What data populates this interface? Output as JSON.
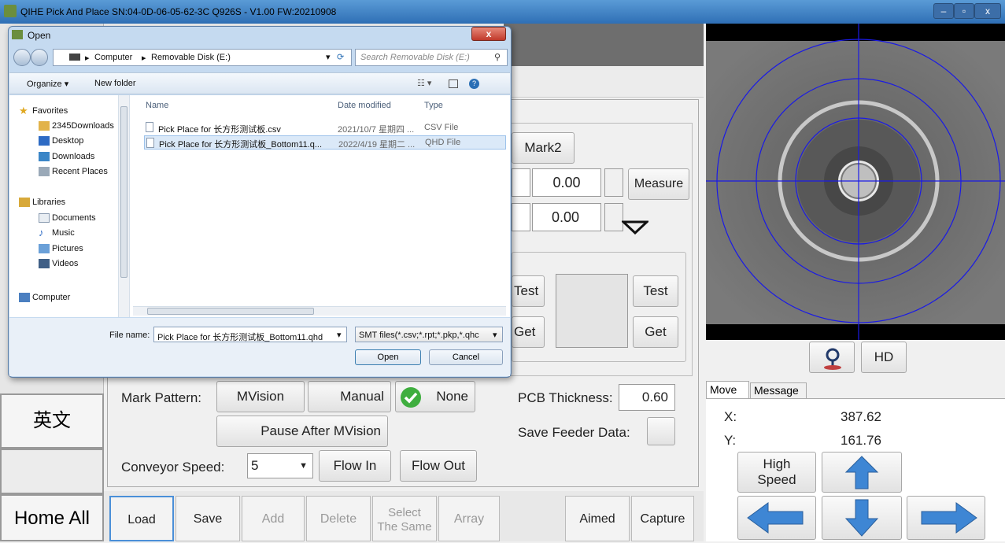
{
  "window": {
    "title": "QIHE Pick And Place   SN:04-0D-06-05-62-3C  Q926S - V1.00   FW:20210908"
  },
  "sidebar": {
    "english_btn": "英文",
    "home_btn": "Home All"
  },
  "panel": {
    "mark2": "Mark2",
    "field1": "0.00",
    "field2": "0.00",
    "measure": "Measure",
    "test_left": "Test",
    "get_left": "Get",
    "test_right": "Test",
    "get_right": "Get",
    "mark_pattern_label": "Mark Pattern:",
    "mvision": "MVision",
    "manual": "Manual",
    "none": "None",
    "pcb_thickness_label": "PCB Thickness:",
    "pcb_thickness_value": "0.60",
    "pause_after_mvision": "Pause After MVision",
    "save_feeder_label": "Save Feeder Data:",
    "conveyor_label": "Conveyor  Speed:",
    "speed_value": "5",
    "flow_in": "Flow In",
    "flow_out": "Flow Out"
  },
  "toolbar": {
    "load": "Load",
    "save": "Save",
    "add": "Add",
    "delete": "Delete",
    "select_same_1": "Select",
    "select_same_2": "The Same",
    "array": "Array",
    "aimed": "Aimed",
    "capture": "Capture"
  },
  "camera": {
    "hd": "HD"
  },
  "move": {
    "tab_move": "Move",
    "tab_message": "Message",
    "x_label": "X:",
    "x_value": "387.62",
    "y_label": "Y:",
    "y_value": "161.76",
    "high_speed_1": "High",
    "high_speed_2": "Speed"
  },
  "dialog": {
    "title": "Open",
    "path_computer": "Computer",
    "path_disk": "Removable Disk (E:)",
    "search_placeholder": "Search Removable Disk (E:)",
    "organize": "Organize ▾",
    "new_folder": "New folder",
    "nav": {
      "favorites": "Favorites",
      "downloads2345": "2345Downloads",
      "desktop": "Desktop",
      "downloads": "Downloads",
      "recent": "Recent Places",
      "libraries": "Libraries",
      "documents": "Documents",
      "music": "Music",
      "pictures": "Pictures",
      "videos": "Videos",
      "computer": "Computer"
    },
    "columns": {
      "name": "Name",
      "date": "Date modified",
      "type": "Type"
    },
    "files": [
      {
        "name": "Pick Place for 长方形测试板.csv",
        "date": "2021/10/7 星期四 ...",
        "type": "CSV File"
      },
      {
        "name": "Pick Place for 长方形测试板_Bottom11.q...",
        "date": "2022/4/19 星期二 ...",
        "type": "QHD File"
      }
    ],
    "filename_label": "File name:",
    "filename_value": "Pick Place for 长方形测试板_Bottom11.qhd",
    "filetype_value": "SMT files(*.csv;*.rpt;*.pkp,*.qhc",
    "open": "Open",
    "cancel": "Cancel"
  }
}
